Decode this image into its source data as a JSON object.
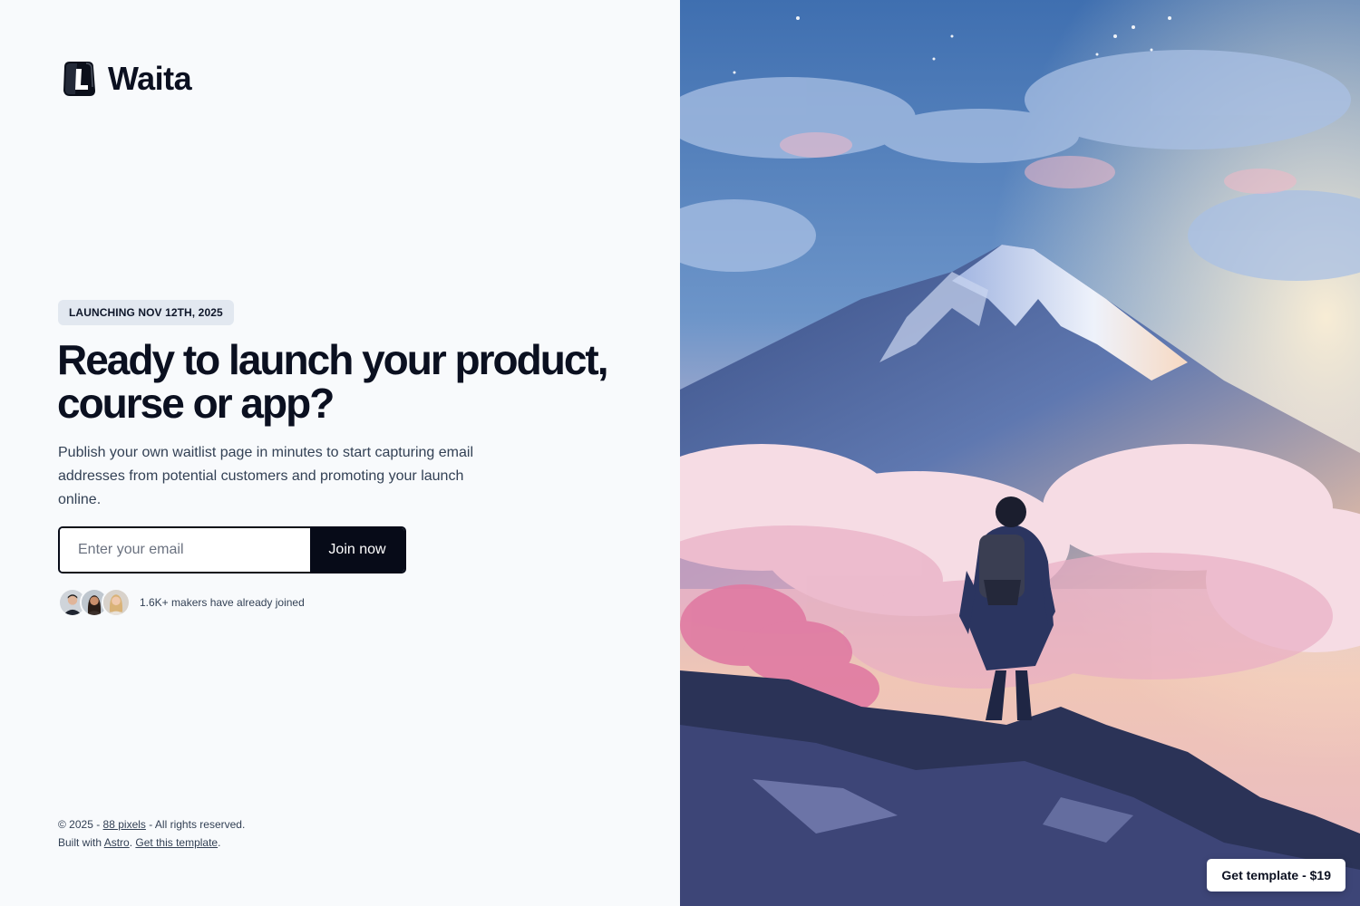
{
  "brand": {
    "name": "Waita",
    "logo_icon": "l-cube-logo-icon"
  },
  "hero": {
    "badge": "LAUNCHING NOV 12TH, 2025",
    "headline_line1": "Ready to launch your product,",
    "headline_line2": "course or app?",
    "subheadline": "Publish your own waitlist page in minutes to start capturing email addresses from potential customers and promoting your launch online."
  },
  "signup": {
    "email_placeholder": "Enter your email",
    "email_value": "",
    "join_label": "Join now"
  },
  "social_proof": {
    "text": "1.6K+ makers have already joined",
    "avatars": [
      "avatar-man",
      "avatar-woman-dark-hair",
      "avatar-woman-blonde"
    ]
  },
  "footer": {
    "copyright_prefix": "© 2025 - ",
    "company_link": "88 pixels",
    "rights": " - All rights reserved.",
    "built_prefix": "Built with ",
    "astro_link": "Astro",
    "sep": ". ",
    "template_link": "Get this template",
    "end": "."
  },
  "cta": {
    "get_template": "Get template - $19"
  },
  "image": {
    "subject": "hiker-overlooking-snowy-mountain-illustration"
  },
  "colors": {
    "accent": "#070b18",
    "badge_bg": "#e2e8f0",
    "page_bg": "#f8fafc"
  }
}
